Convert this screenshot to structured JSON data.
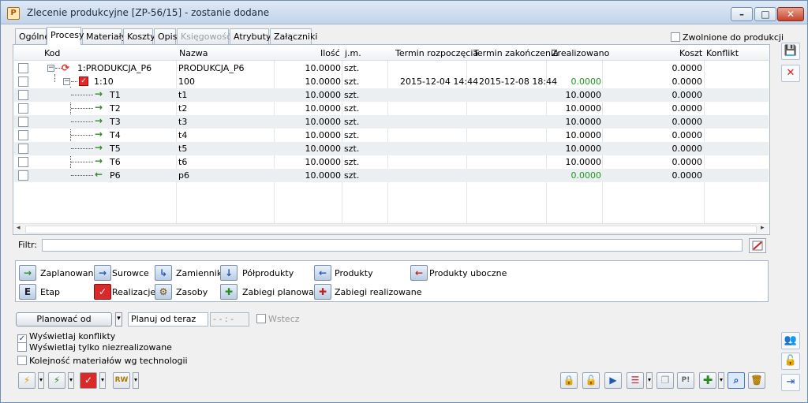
{
  "window": {
    "title": "Zlecenie produkcyjne  [ZP-56/15] - zostanie dodane",
    "app_icon_letter": "P",
    "minimize_glyph": "–",
    "maximize_glyph": "□",
    "close_glyph": "✕"
  },
  "tabs": [
    {
      "label": "Ogólne"
    },
    {
      "label": "Procesy"
    },
    {
      "label": "Materiały"
    },
    {
      "label": "Koszty"
    },
    {
      "label": "Opis"
    },
    {
      "label": "Księgowość"
    },
    {
      "label": "Atrybuty"
    },
    {
      "label": "Załączniki"
    }
  ],
  "zwolnione_label": "Zwolnione do produkcji",
  "grid": {
    "headers": {
      "kod": "Kod",
      "nazwa": "Nazwa",
      "ilosc": "Ilość",
      "jm": "j.m.",
      "termin_rozp": "Termin rozpoczęcia",
      "termin_zak": "Termin zakończenia",
      "zrealizowano": "Zrealizowano",
      "koszt": "Koszt",
      "konflikt": "Konflikt"
    },
    "rows": [
      {
        "kod": "1:PRODUKCJA_P6",
        "nazwa": "PRODUKCJA_P6",
        "ilosc": "10.0000",
        "jm": "szt.",
        "start": "",
        "end": "",
        "zreal": "",
        "koszt": "0.0000",
        "konflikt": ""
      },
      {
        "kod": "1:10",
        "nazwa": "100",
        "ilosc": "10.0000",
        "jm": "szt.",
        "start": "2015-12-04 14:44",
        "end": "2015-12-08 18:44",
        "zreal": "0.0000",
        "koszt": "0.0000",
        "konflikt": ""
      },
      {
        "kod": "T1",
        "nazwa": "t1",
        "ilosc": "10.0000",
        "jm": "szt.",
        "start": "",
        "end": "",
        "zreal": "10.0000",
        "koszt": "0.0000",
        "konflikt": ""
      },
      {
        "kod": "T2",
        "nazwa": "t2",
        "ilosc": "10.0000",
        "jm": "szt.",
        "start": "",
        "end": "",
        "zreal": "10.0000",
        "koszt": "0.0000",
        "konflikt": ""
      },
      {
        "kod": "T3",
        "nazwa": "t3",
        "ilosc": "10.0000",
        "jm": "szt.",
        "start": "",
        "end": "",
        "zreal": "10.0000",
        "koszt": "0.0000",
        "konflikt": ""
      },
      {
        "kod": "T4",
        "nazwa": "t4",
        "ilosc": "10.0000",
        "jm": "szt.",
        "start": "",
        "end": "",
        "zreal": "10.0000",
        "koszt": "0.0000",
        "konflikt": ""
      },
      {
        "kod": "T5",
        "nazwa": "t5",
        "ilosc": "10.0000",
        "jm": "szt.",
        "start": "",
        "end": "",
        "zreal": "10.0000",
        "koszt": "0.0000",
        "konflikt": ""
      },
      {
        "kod": "T6",
        "nazwa": "t6",
        "ilosc": "10.0000",
        "jm": "szt.",
        "start": "",
        "end": "",
        "zreal": "10.0000",
        "koszt": "0.0000",
        "konflikt": ""
      },
      {
        "kod": "P6",
        "nazwa": "p6",
        "ilosc": "10.0000",
        "jm": "szt.",
        "start": "",
        "end": "",
        "zreal": "0.0000",
        "koszt": "0.0000",
        "konflikt": ""
      }
    ]
  },
  "filter_label": "Filtr:",
  "filter_value": "",
  "legend": {
    "zaplanowane": "Zaplanowane",
    "surowce": "Surowce",
    "zamienniki": "Zamienniki",
    "polprodukty": "Półprodukty",
    "produkty": "Produkty",
    "produkty_uboczne": "Produkty uboczne",
    "etap": "Etap",
    "realizacje": "Realizacje",
    "zasoby": "Zasoby",
    "zabiegi_planowane": "Zabiegi planowane",
    "zabiegi_realizowane": "Zabiegi realizowane",
    "etap_letter": "E"
  },
  "planning": {
    "planuj_button": "Planować od",
    "planuj_od": "Planuj od teraz",
    "time_value": "- - : -",
    "wstecz": "Wstecz"
  },
  "options": {
    "konflikty": "Wyświetlaj konflikty",
    "niezrealizowane": "Wyświetlaj tylko niezrealizowane",
    "kolejnosc": "Kolejność materiałów wg technologii"
  },
  "bottom_labels": {
    "rw": "RW",
    "p_excl": "P!"
  }
}
